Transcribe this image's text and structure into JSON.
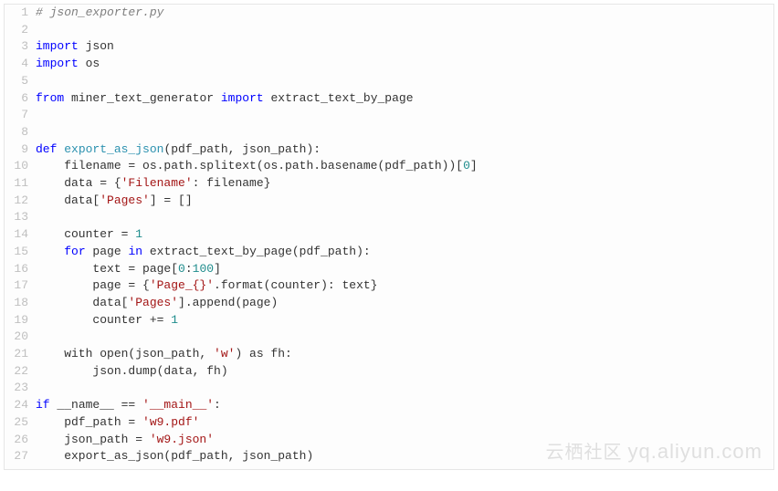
{
  "watermark": {
    "cn": "云栖社区",
    "url": "yq.aliyun.com"
  },
  "code": {
    "lines": [
      {
        "n": 1,
        "tokens": [
          {
            "cls": "comment",
            "t": "# json_exporter.py"
          }
        ]
      },
      {
        "n": 2,
        "tokens": []
      },
      {
        "n": 3,
        "tokens": [
          {
            "cls": "keyword",
            "t": "import"
          },
          {
            "t": " json"
          }
        ]
      },
      {
        "n": 4,
        "tokens": [
          {
            "cls": "keyword",
            "t": "import"
          },
          {
            "t": " os"
          }
        ]
      },
      {
        "n": 5,
        "tokens": []
      },
      {
        "n": 6,
        "tokens": [
          {
            "cls": "keyword",
            "t": "from"
          },
          {
            "t": " miner_text_generator "
          },
          {
            "cls": "keyword",
            "t": "import"
          },
          {
            "t": " extract_text_by_page"
          }
        ]
      },
      {
        "n": 7,
        "tokens": []
      },
      {
        "n": 8,
        "tokens": []
      },
      {
        "n": 9,
        "tokens": [
          {
            "cls": "keyword",
            "t": "def"
          },
          {
            "t": " "
          },
          {
            "cls": "builtin",
            "t": "export_as_json"
          },
          {
            "t": "(pdf_path, json_path):"
          }
        ]
      },
      {
        "n": 10,
        "tokens": [
          {
            "t": "    filename = os.path.splitext(os.path.basename(pdf_path))["
          },
          {
            "cls": "number",
            "t": "0"
          },
          {
            "t": "]"
          }
        ]
      },
      {
        "n": 11,
        "tokens": [
          {
            "t": "    data = {"
          },
          {
            "cls": "string",
            "t": "'Filename'"
          },
          {
            "t": ": filename}"
          }
        ]
      },
      {
        "n": 12,
        "tokens": [
          {
            "t": "    data["
          },
          {
            "cls": "string",
            "t": "'Pages'"
          },
          {
            "t": "] = []"
          }
        ]
      },
      {
        "n": 13,
        "tokens": []
      },
      {
        "n": 14,
        "tokens": [
          {
            "t": "    counter = "
          },
          {
            "cls": "number",
            "t": "1"
          }
        ]
      },
      {
        "n": 15,
        "tokens": [
          {
            "t": "    "
          },
          {
            "cls": "keyword",
            "t": "for"
          },
          {
            "t": " page "
          },
          {
            "cls": "keyword",
            "t": "in"
          },
          {
            "t": " extract_text_by_page(pdf_path):"
          }
        ]
      },
      {
        "n": 16,
        "tokens": [
          {
            "t": "        text = page["
          },
          {
            "cls": "number",
            "t": "0"
          },
          {
            "t": ":"
          },
          {
            "cls": "number",
            "t": "100"
          },
          {
            "t": "]"
          }
        ]
      },
      {
        "n": 17,
        "tokens": [
          {
            "t": "        page = {"
          },
          {
            "cls": "string",
            "t": "'Page_{}'"
          },
          {
            "t": ".format(counter): text}"
          }
        ]
      },
      {
        "n": 18,
        "tokens": [
          {
            "t": "        data["
          },
          {
            "cls": "string",
            "t": "'Pages'"
          },
          {
            "t": "].append(page)"
          }
        ]
      },
      {
        "n": 19,
        "tokens": [
          {
            "t": "        counter += "
          },
          {
            "cls": "number",
            "t": "1"
          }
        ]
      },
      {
        "n": 20,
        "tokens": []
      },
      {
        "n": 21,
        "tokens": [
          {
            "t": "    with open(json_path, "
          },
          {
            "cls": "string",
            "t": "'w'"
          },
          {
            "t": ") as fh:"
          }
        ]
      },
      {
        "n": 22,
        "tokens": [
          {
            "t": "        json.dump(data, fh)"
          }
        ]
      },
      {
        "n": 23,
        "tokens": []
      },
      {
        "n": 24,
        "tokens": [
          {
            "cls": "keyword",
            "t": "if"
          },
          {
            "t": " __name__ == "
          },
          {
            "cls": "string",
            "t": "'__main__'"
          },
          {
            "t": ":"
          }
        ]
      },
      {
        "n": 25,
        "tokens": [
          {
            "t": "    pdf_path = "
          },
          {
            "cls": "string",
            "t": "'w9.pdf'"
          }
        ]
      },
      {
        "n": 26,
        "tokens": [
          {
            "t": "    json_path = "
          },
          {
            "cls": "string",
            "t": "'w9.json'"
          }
        ]
      },
      {
        "n": 27,
        "tokens": [
          {
            "t": "    export_as_json(pdf_path, json_path)"
          }
        ]
      }
    ]
  }
}
